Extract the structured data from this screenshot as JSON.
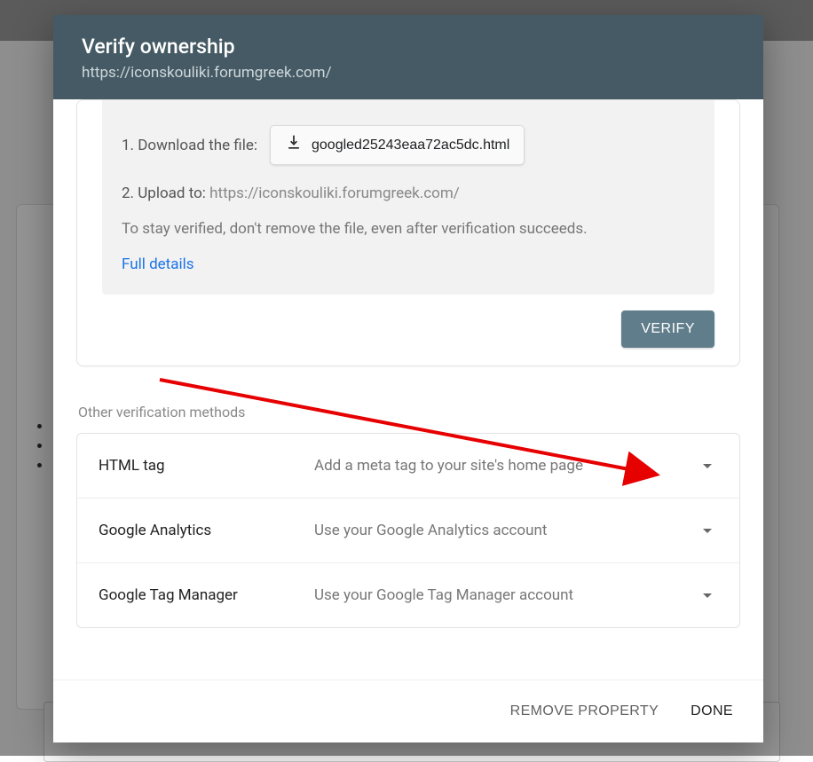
{
  "header": {
    "title": "Verify ownership",
    "subtitle": "https://iconskouliki.forumgreek.com/"
  },
  "file_method": {
    "step1_label": "1. Download the file:",
    "filename": "googled25243eaa72ac5dc.html",
    "step2_prefix": "2. Upload to: ",
    "step2_url": "https://iconskouliki.forumgreek.com/",
    "note": "To stay verified, don't remove the file, even after verification succeeds.",
    "details_link": "Full details",
    "verify_label": "VERIFY"
  },
  "other_section_label": "Other verification methods",
  "methods": [
    {
      "name": "HTML tag",
      "desc": "Add a meta tag to your site's home page"
    },
    {
      "name": "Google Analytics",
      "desc": "Use your Google Analytics account"
    },
    {
      "name": "Google Tag Manager",
      "desc": "Use your Google Tag Manager account"
    }
  ],
  "footer": {
    "remove": "REMOVE PROPERTY",
    "done": "DONE"
  }
}
